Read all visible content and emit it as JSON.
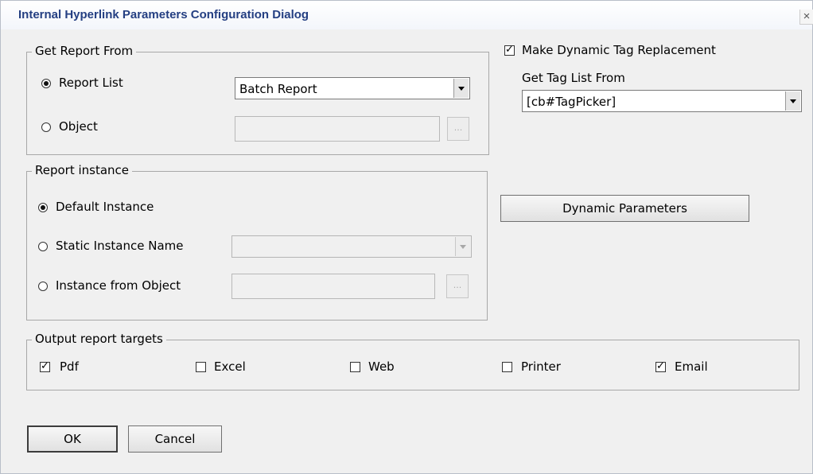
{
  "window": {
    "title": "Internal Hyperlink Parameters Configuration Dialog",
    "close_glyph": "×"
  },
  "get_report_from": {
    "legend": "Get Report From",
    "report_list_label": "Report List",
    "report_list_value": "Batch Report",
    "object_label": "Object",
    "object_value": "",
    "browse_label": "..."
  },
  "report_instance": {
    "legend": "Report instance",
    "default_label": "Default Instance",
    "static_label": "Static Instance Name",
    "static_value": "",
    "from_object_label": "Instance from Object",
    "from_object_value": "",
    "browse_label": "..."
  },
  "dynamic": {
    "make_replacement_label": "Make Dynamic Tag Replacement",
    "make_replacement_checked": true,
    "tag_list_label": "Get Tag List From",
    "tag_list_value": "[cb#TagPicker]",
    "dynamic_parameters_label": "Dynamic Parameters"
  },
  "output_targets": {
    "legend": "Output report targets",
    "items": [
      {
        "label": "Pdf",
        "checked": true
      },
      {
        "label": "Excel",
        "checked": false
      },
      {
        "label": "Web",
        "checked": false
      },
      {
        "label": "Printer",
        "checked": false
      },
      {
        "label": "Email",
        "checked": true
      }
    ]
  },
  "buttons": {
    "ok": "OK",
    "cancel": "Cancel"
  },
  "check_glyph": "✓"
}
